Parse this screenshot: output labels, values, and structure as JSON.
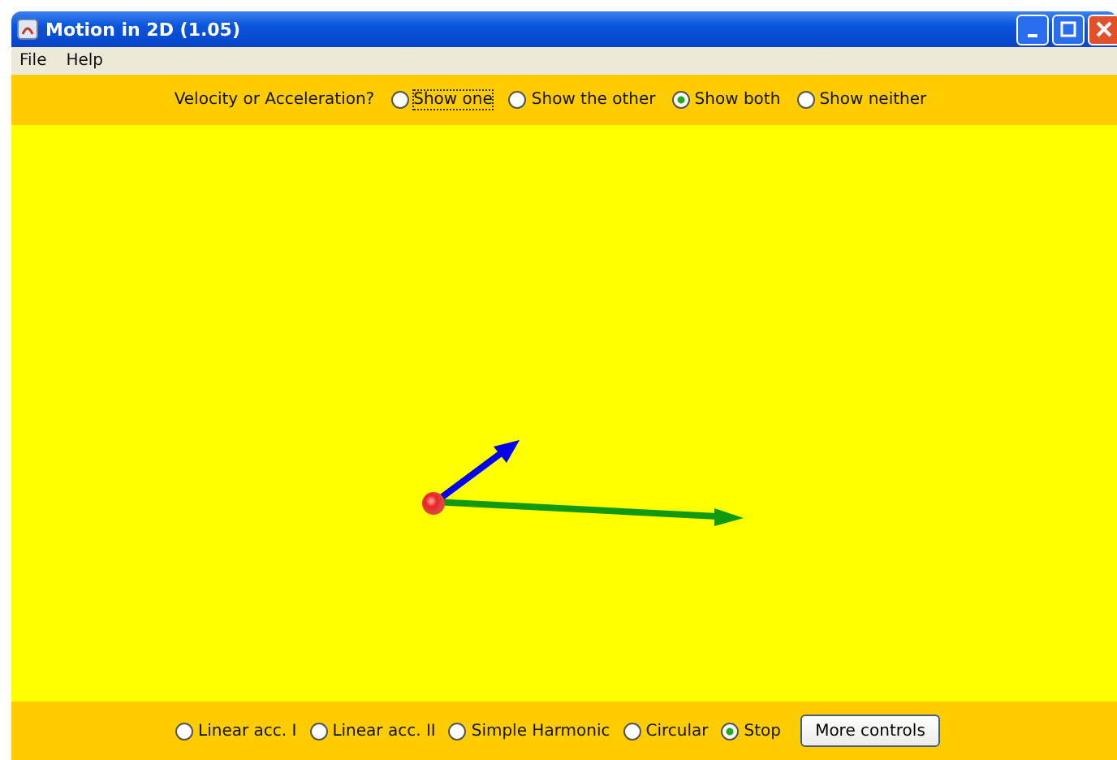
{
  "window": {
    "title": "Motion in 2D (1.05)"
  },
  "menu": [
    "File",
    "Help"
  ],
  "vector_options": {
    "label": "Velocity or Acceleration?",
    "options": [
      {
        "label": "Show one",
        "selected": false,
        "focused": true
      },
      {
        "label": "Show the other",
        "selected": false,
        "focused": false
      },
      {
        "label": "Show both",
        "selected": true,
        "focused": false
      },
      {
        "label": "Show neither",
        "selected": false,
        "focused": false
      }
    ]
  },
  "motion_options": [
    {
      "label": "Linear acc. I",
      "selected": false
    },
    {
      "label": "Linear acc. II",
      "selected": false
    },
    {
      "label": "Simple Harmonic",
      "selected": false
    },
    {
      "label": "Circular",
      "selected": false
    },
    {
      "label": "Stop",
      "selected": true
    }
  ],
  "more_button": "More controls"
}
